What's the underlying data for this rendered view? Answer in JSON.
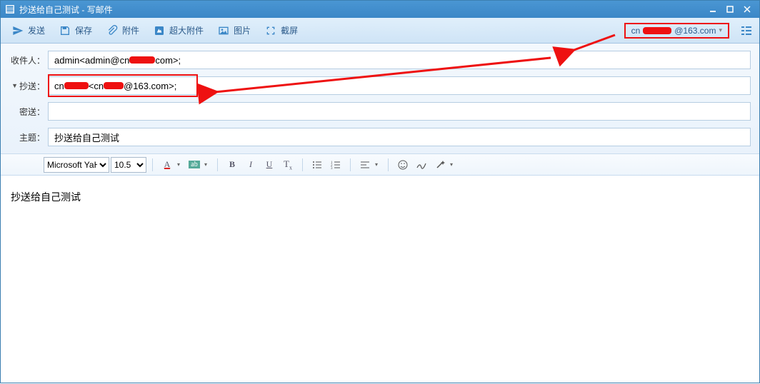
{
  "window": {
    "title": "抄送给自己测试 - 写邮件"
  },
  "toolbar": {
    "send": "发送",
    "save": "保存",
    "attach": "附件",
    "bigattach": "超大附件",
    "image": "图片",
    "screenshot": "截屏"
  },
  "account": {
    "prefix": "cn",
    "suffix": "@163.com"
  },
  "fields": {
    "to_label": "收件人：",
    "to_value_pre": "admin<admin@cn",
    "to_value_post": "com>;",
    "cc_label": "抄送：",
    "cc_value_pre": "cn",
    "cc_value_mid": "<cn",
    "cc_value_post": "@163.com>;",
    "bcc_label": "密送：",
    "bcc_value": "",
    "subject_label": "主题：",
    "subject_value": "抄送给自己测试"
  },
  "editor": {
    "font_family": "Microsoft YaHei",
    "font_size": "10.5",
    "body_text": "抄送给自己测试"
  }
}
